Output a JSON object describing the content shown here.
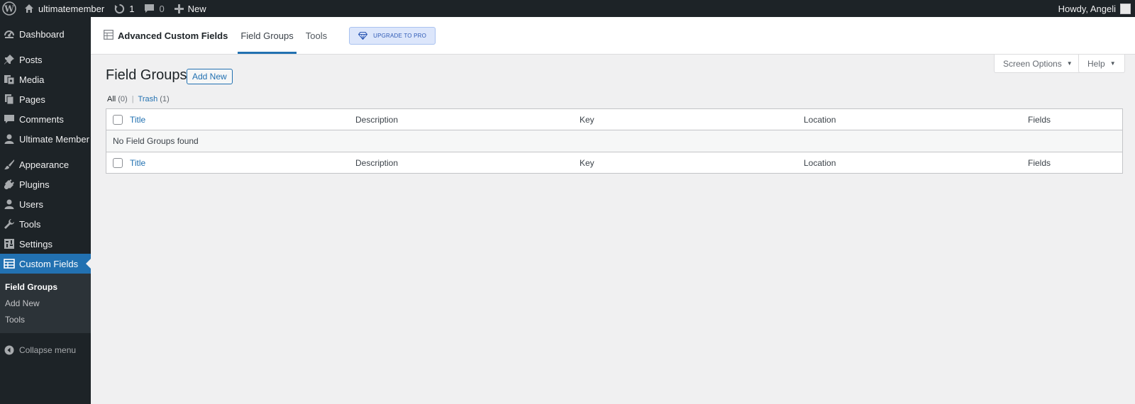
{
  "adminbar": {
    "site_name": "ultimatemember",
    "updates_count": "1",
    "comments_count": "0",
    "new_label": "New",
    "greeting": "Howdy, Angeli"
  },
  "sidebar": {
    "items": [
      {
        "label": "Dashboard",
        "icon": "dashboard-icon"
      },
      {
        "label": "Posts",
        "icon": "pushpin-icon"
      },
      {
        "label": "Media",
        "icon": "media-icon"
      },
      {
        "label": "Pages",
        "icon": "pages-icon"
      },
      {
        "label": "Comments",
        "icon": "comment-icon"
      },
      {
        "label": "Ultimate Member",
        "icon": "user-icon"
      },
      {
        "label": "Appearance",
        "icon": "brush-icon"
      },
      {
        "label": "Plugins",
        "icon": "plugin-icon"
      },
      {
        "label": "Users",
        "icon": "users-icon"
      },
      {
        "label": "Tools",
        "icon": "wrench-icon"
      },
      {
        "label": "Settings",
        "icon": "settings-icon"
      },
      {
        "label": "Custom Fields",
        "icon": "table-icon"
      }
    ],
    "submenu": [
      "Field Groups",
      "Add New",
      "Tools"
    ],
    "collapse_label": "Collapse menu"
  },
  "acf_header": {
    "brand": "Advanced Custom Fields",
    "tabs": [
      "Field Groups",
      "Tools"
    ],
    "upgrade_label": "UPGRADE TO PRO"
  },
  "screen_meta": {
    "screen_options": "Screen Options",
    "help": "Help"
  },
  "main": {
    "title": "Field Groups",
    "add_new": "Add New",
    "filters": {
      "all_label": "All",
      "all_count": "(0)",
      "separator": "|",
      "trash_label": "Trash",
      "trash_count": "(1)"
    },
    "table": {
      "columns": [
        "Title",
        "Description",
        "Key",
        "Location",
        "Fields"
      ],
      "empty_message": "No Field Groups found"
    }
  },
  "colors": {
    "admin_dark": "#1d2327",
    "accent": "#2271b1",
    "background": "#f0f0f1"
  }
}
